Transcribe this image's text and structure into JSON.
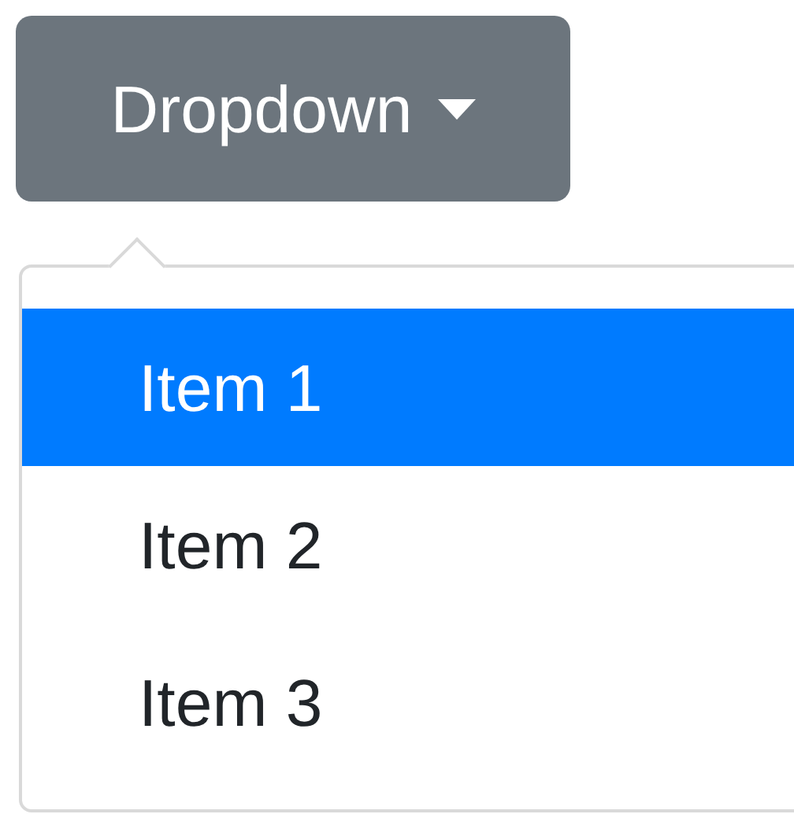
{
  "button": {
    "label": "Dropdown"
  },
  "menu": {
    "items": [
      {
        "label": "Item 1",
        "selected": true
      },
      {
        "label": "Item 2",
        "selected": false
      },
      {
        "label": "Item 3",
        "selected": false
      }
    ]
  }
}
